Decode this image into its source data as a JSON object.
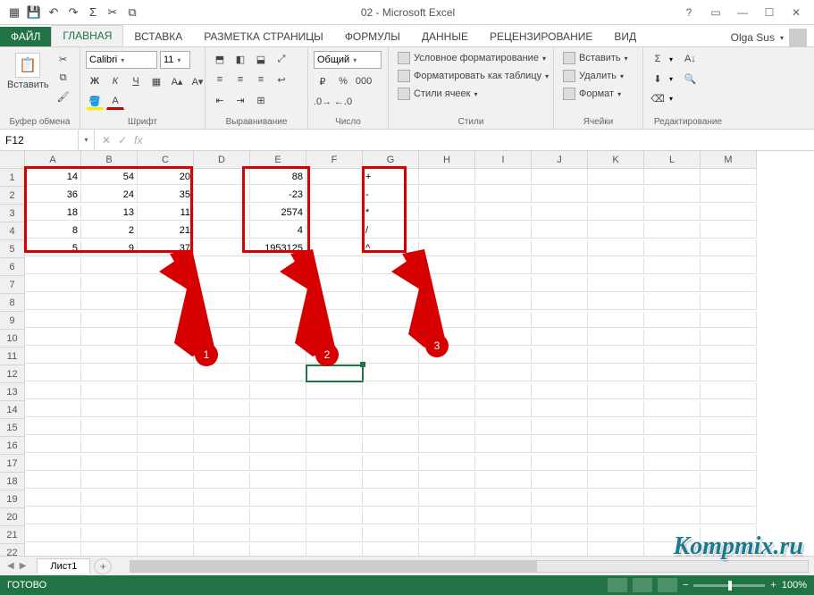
{
  "app": {
    "title": "02 - Microsoft Excel"
  },
  "user": {
    "name": "Olga Sus"
  },
  "tabs": {
    "file": "ФАЙЛ",
    "home": "ГЛАВНАЯ",
    "insert": "ВСТАВКА",
    "pagelayout": "РАЗМЕТКА СТРАНИЦЫ",
    "formulas": "ФОРМУЛЫ",
    "data": "ДАННЫЕ",
    "review": "РЕЦЕНЗИРОВАНИЕ",
    "view": "ВИД"
  },
  "ribbon": {
    "clipboard": {
      "paste": "Вставить",
      "label": "Буфер обмена"
    },
    "font": {
      "name": "Calibri",
      "size": "11",
      "label": "Шрифт",
      "bold": "Ж",
      "italic": "К",
      "underline": "Ч"
    },
    "alignment": {
      "label": "Выравнивание"
    },
    "number": {
      "format": "Общий",
      "label": "Число"
    },
    "styles": {
      "conditional": "Условное форматирование",
      "table": "Форматировать как таблицу",
      "cell": "Стили ячеек",
      "label": "Стили"
    },
    "cells": {
      "insert": "Вставить",
      "delete": "Удалить",
      "format": "Формат",
      "label": "Ячейки"
    },
    "editing": {
      "label": "Редактирование"
    }
  },
  "namebox": "F12",
  "columns": [
    "A",
    "B",
    "C",
    "D",
    "E",
    "F",
    "G",
    "H",
    "I",
    "J",
    "K",
    "L",
    "M"
  ],
  "grid": {
    "r1": {
      "A": "14",
      "B": "54",
      "C": "20",
      "E": "88",
      "G": "+"
    },
    "r2": {
      "A": "36",
      "B": "24",
      "C": "35",
      "E": "-23",
      "G": "-"
    },
    "r3": {
      "A": "18",
      "B": "13",
      "C": "11",
      "E": "2574",
      "G": "*"
    },
    "r4": {
      "A": "8",
      "B": "2",
      "C": "21",
      "E": "4",
      "G": "/"
    },
    "r5": {
      "A": "5",
      "B": "9",
      "C": "37",
      "E": "1953125",
      "G": "^"
    }
  },
  "annotations": {
    "b1": "1",
    "b2": "2",
    "b3": "3"
  },
  "sheet": {
    "name": "Лист1"
  },
  "status": {
    "ready": "ГОТОВО",
    "zoom": "100%"
  },
  "watermark": "Kompmix.ru"
}
